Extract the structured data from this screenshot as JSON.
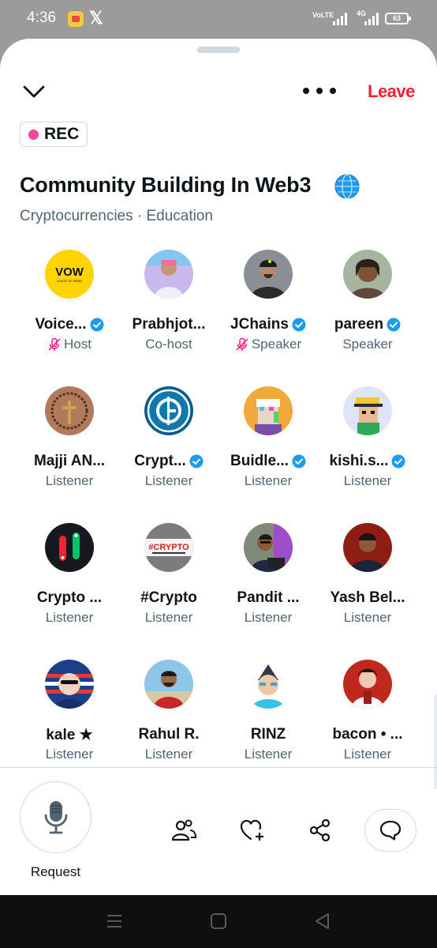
{
  "status_bar": {
    "time": "4:36",
    "volte": "VoLTE",
    "network": "4G",
    "battery": "63"
  },
  "header": {
    "leave_label": "Leave",
    "rec_label": "REC"
  },
  "space": {
    "title": "Community Building In Web3",
    "topics": "Cryptocurrencies · Education"
  },
  "participants": [
    {
      "name": "Voice...",
      "role": "Host",
      "verified": true,
      "muted": true
    },
    {
      "name": "Prabhjot...",
      "role": "Co-host",
      "verified": false,
      "muted": false
    },
    {
      "name": "JChains",
      "role": "Speaker",
      "verified": true,
      "muted": true
    },
    {
      "name": "pareen",
      "role": "Speaker",
      "verified": true,
      "muted": false
    },
    {
      "name": "Majji AN...",
      "role": "Listener",
      "verified": false,
      "muted": false
    },
    {
      "name": "Crypt...",
      "role": "Listener",
      "verified": true,
      "muted": false
    },
    {
      "name": "Buidle...",
      "role": "Listener",
      "verified": true,
      "muted": false
    },
    {
      "name": "kishi.s...",
      "role": "Listener",
      "verified": true,
      "muted": false
    },
    {
      "name": "Crypto ...",
      "role": "Listener",
      "verified": false,
      "muted": false
    },
    {
      "name": "#Crypto",
      "role": "Listener",
      "verified": false,
      "muted": false
    },
    {
      "name": "Pandit ...",
      "role": "Listener",
      "verified": false,
      "muted": false
    },
    {
      "name": "Yash Bel...",
      "role": "Listener",
      "verified": false,
      "muted": false
    },
    {
      "name": "kale ★",
      "role": "Listener",
      "verified": false,
      "muted": false
    },
    {
      "name": "Rahul R.",
      "role": "Listener",
      "verified": false,
      "muted": false
    },
    {
      "name": "RINZ",
      "role": "Listener",
      "verified": false,
      "muted": false
    },
    {
      "name": "bacon • ...",
      "role": "Listener",
      "verified": false,
      "muted": false
    }
  ],
  "avatar_logos": {
    "vow": "VOW",
    "vow_sub": "VOICE OF WEB3",
    "crypto_tag": "#CRYPTO"
  },
  "bottom_bar": {
    "request_label": "Request"
  },
  "colors": {
    "accent_red": "#f4212e",
    "rec_pink": "#f4479b",
    "verified_blue": "#1d9bf0",
    "text_primary": "#0f1419",
    "text_secondary": "#536471",
    "mute_pink": "#f91880"
  }
}
